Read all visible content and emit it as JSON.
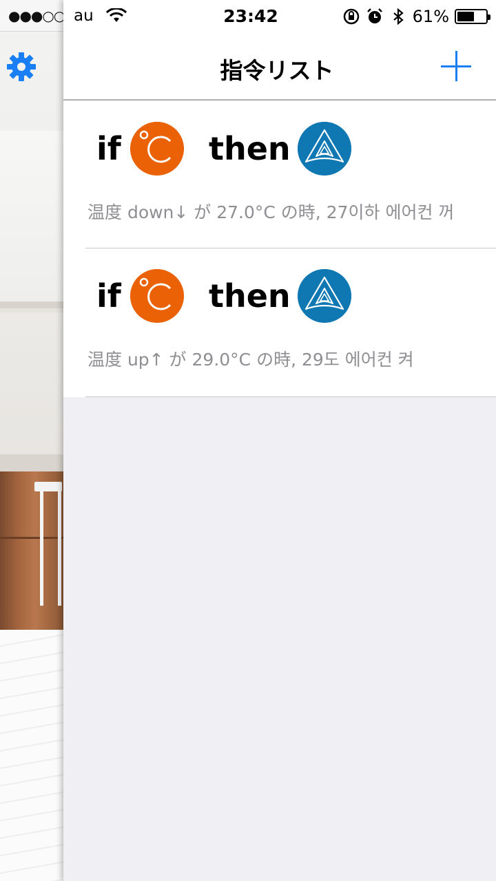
{
  "statusbar": {
    "carrier": "au",
    "time": "23:42",
    "battery_pct": "61%",
    "battery_level": 0.61
  },
  "background_app": {
    "signal": "●●●○○"
  },
  "navbar": {
    "title": "指令リスト"
  },
  "rules": [
    {
      "if_label": "if",
      "then_label": "then",
      "description": "温度 down↓ が 27.0°C の時, 27이하 에어컨 꺼"
    },
    {
      "if_label": "if",
      "then_label": "then",
      "description": "温度 up↑ が 29.0°C の時, 29도 에어컨 켜"
    }
  ],
  "colors": {
    "accent": "#1a7ff5",
    "temperature_icon": "#ea6205",
    "aircon_icon": "#0f78b3",
    "list_background": "#efeff4",
    "secondary_text": "#8e8e93"
  },
  "icons": {
    "settings": "gear-icon",
    "add": "plus-icon",
    "trigger": "temperature-celsius-icon",
    "action": "aircon-triangle-icon"
  }
}
